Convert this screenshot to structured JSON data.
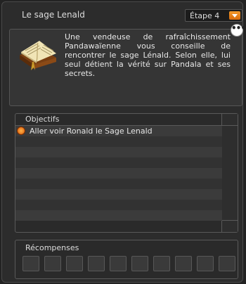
{
  "header": {
    "title": "Le sage Lenald",
    "step": "Étape 4"
  },
  "description": "Une vendeuse de rafraîchissement Pandawaïenne vous conseille de rencontrer le sage Lénald. Selon elle, lui seul détient la vérité sur Pandala et ses secrets.",
  "more_button": "•••",
  "objectives": {
    "title": "Objectifs",
    "items": [
      {
        "label": "Aller voir Ronald le Sage Lenald",
        "icon": "objective-icon"
      }
    ]
  },
  "rewards": {
    "title": "Récompenses",
    "slot_count": 10
  },
  "colors": {
    "accent": "#f39a2a",
    "background": "#2c2c2c"
  }
}
